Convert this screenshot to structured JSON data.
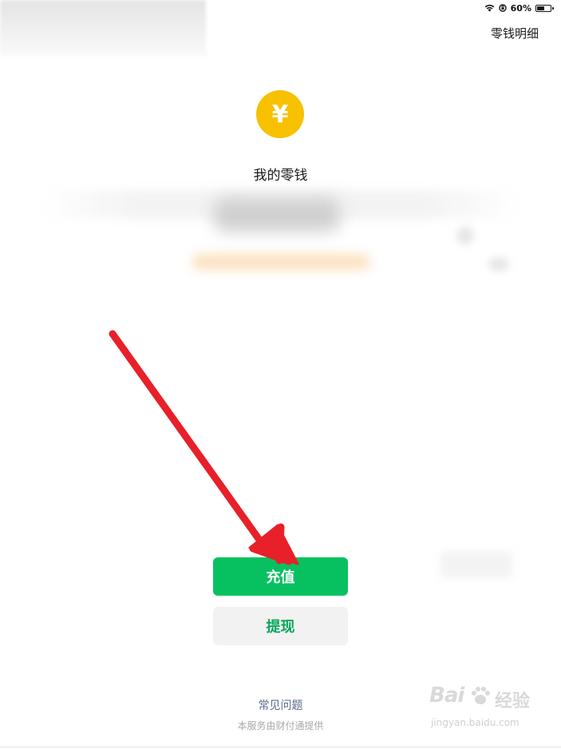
{
  "status_bar": {
    "battery_text": "60%",
    "battery_level": 0.6,
    "wifi_icon": "wifi-icon",
    "lock_icon": "rotation-lock-icon"
  },
  "header": {
    "detail_link": "零钱明细"
  },
  "wallet": {
    "coin_icon": "yuan-coin-icon",
    "coin_symbol": "¥",
    "title": "我的零钱"
  },
  "actions": {
    "recharge_label": "充值",
    "withdraw_label": "提现"
  },
  "footer": {
    "faq_label": "常见问题",
    "service_note": "本服务由财付通提供"
  },
  "watermark": {
    "logo": "Bai",
    "brand": "经验",
    "url": "jingyan.baidu.com"
  },
  "colors": {
    "primary_green": "#07c160",
    "coin_yellow": "#f7c100",
    "arrow_red": "#e8202a"
  }
}
